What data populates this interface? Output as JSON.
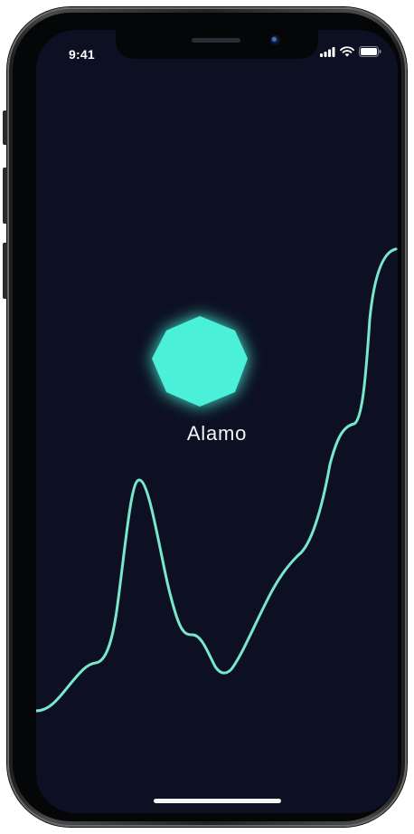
{
  "status_bar": {
    "time": "9:41"
  },
  "app": {
    "title": "Alamo"
  },
  "colors": {
    "background": "#0c1022",
    "accent": "#4cf0d8",
    "line": "#78e8cc"
  },
  "icons": {
    "signal": "cellular-signal-icon",
    "wifi": "wifi-icon",
    "battery": "battery-icon",
    "logo": "octagon-icon"
  }
}
